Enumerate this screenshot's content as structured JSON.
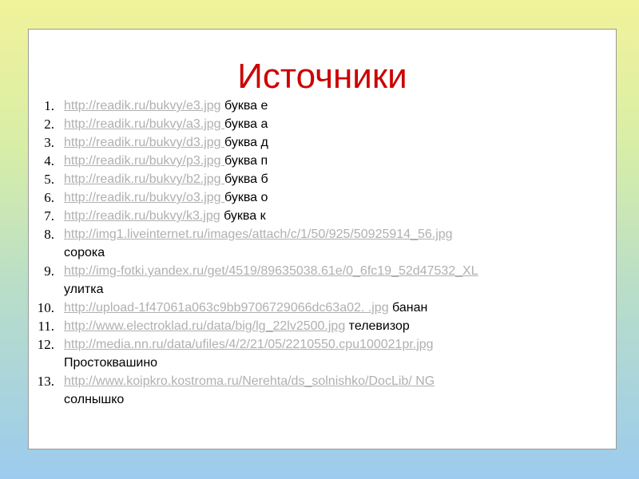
{
  "title": "Источники",
  "sources": [
    {
      "num": "1.",
      "url": "http://readik.ru/bukvy/e3.jpg",
      "desc": "буква е"
    },
    {
      "num": "2.",
      "url": "http://readik.ru/bukvy/a3.jpg ",
      "desc": "буква а"
    },
    {
      "num": "3.",
      "url": "http://readik.ru/bukvy/d3.jpg ",
      "desc": "буква д"
    },
    {
      "num": "4.",
      "url": "http://readik.ru/bukvy/p3.jpg ",
      "desc": "буква п"
    },
    {
      "num": "5.",
      "url": "http://readik.ru/bukvy/b2.jpg ",
      "desc": "буква б"
    },
    {
      "num": "6.",
      "url": "http://readik.ru/bukvy/o3.jpg ",
      "desc": "буква о"
    },
    {
      "num": "7.",
      "url": "http://readik.ru/bukvy/k3.jpg",
      "desc": "буква к"
    },
    {
      "num": "8.",
      "url": "http://img1.liveinternet.ru/images/attach/c/1/50/925/50925914_56.jpg",
      "desc": "сорока"
    },
    {
      "num": "9.",
      "url": "http://img-fotki.yandex.ru/get/4519/89635038.61e/0_6fc19_52d47532_XL",
      "desc": "улитка"
    },
    {
      "num": "10.",
      "url": " http://upload-1f47061a063c9bb9706729066dc63a02. .jpg",
      "desc": "банан"
    },
    {
      "num": "11.",
      "url": " http://www.electroklad.ru/data/big/lg_22lv2500.jpg",
      "desc": "телевизор"
    },
    {
      "num": "12.",
      "url": " http://media.nn.ru/data/ufiles/4/2/21/05/2210550.cpu100021pr.jpg",
      "desc": "Простоквашино"
    },
    {
      "num": "13.",
      "url": " http://www.koipkro.kostroma.ru/Nerehta/ds_solnishko/DocLib/ NG",
      "desc": "солнышко"
    }
  ]
}
